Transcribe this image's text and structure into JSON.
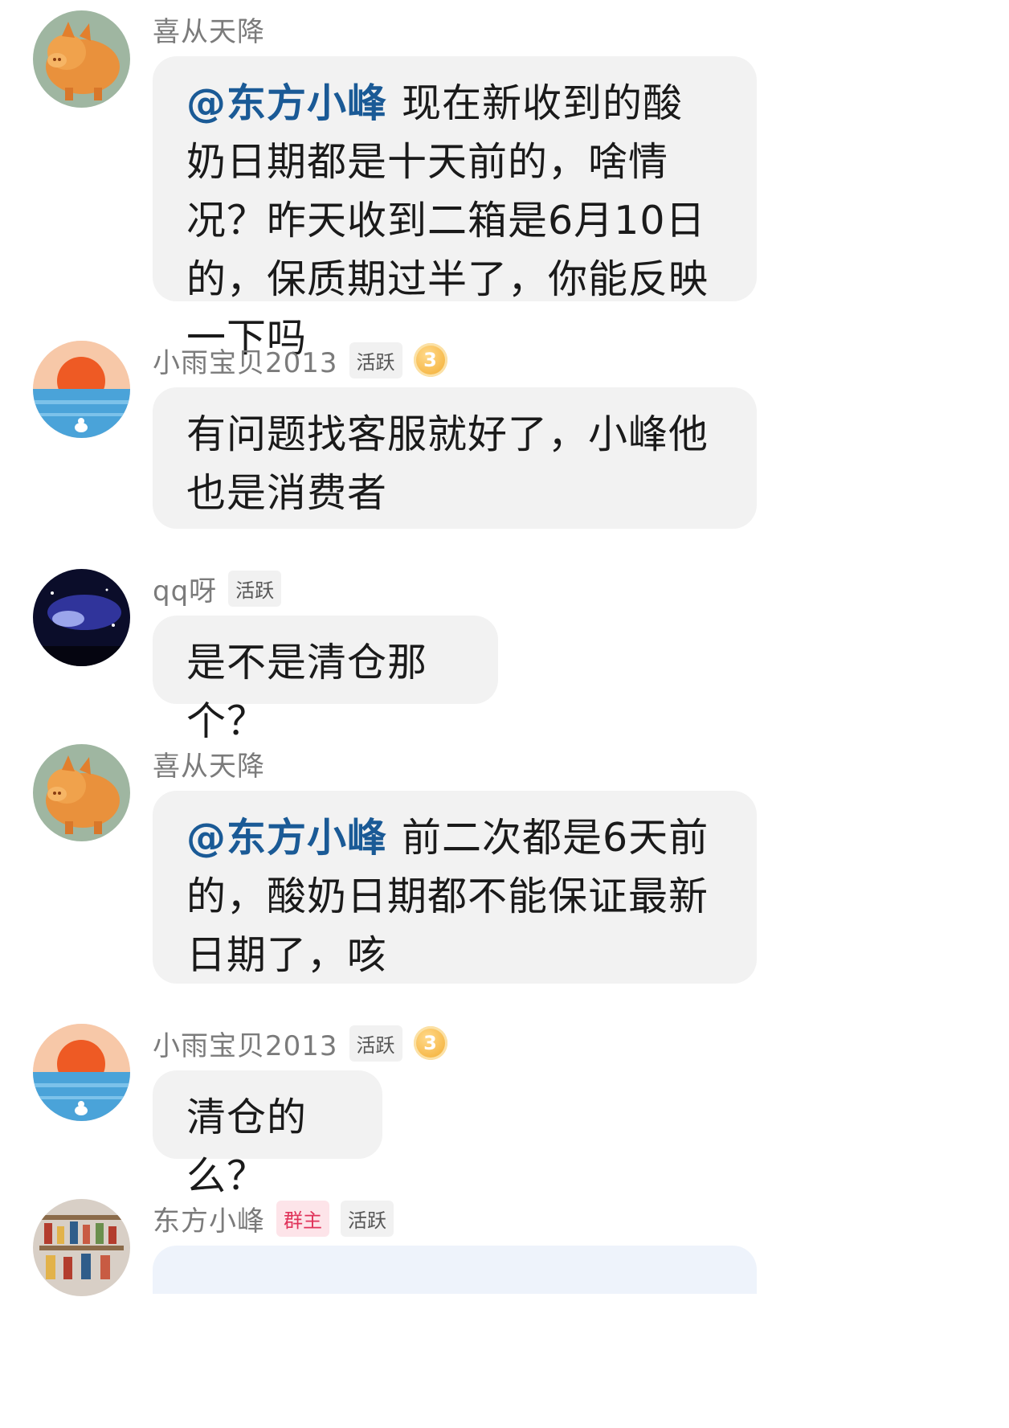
{
  "messages": [
    {
      "sender": "喜从天降",
      "avatar": "pig-avatar-icon",
      "mention": "@东方小峰",
      "text": "现在新收到的酸奶日期都是十天前的，啥情况？昨天收到二箱是6月10日的，保质期过半了，你能反映一下吗"
    },
    {
      "sender": "小雨宝贝2013",
      "avatar": "sunset-avatar-icon",
      "tags": [
        "活跃"
      ],
      "level": "3",
      "text": "有问题找客服就好了，小峰他也是消费者"
    },
    {
      "sender": "qq呀",
      "avatar": "night-sky-avatar-icon",
      "tags": [
        "活跃"
      ],
      "text": "是不是清仓那个？"
    },
    {
      "sender": "喜从天降",
      "avatar": "pig-avatar-icon",
      "mention": "@东方小峰",
      "text": "前二次都是6天前的，酸奶日期都不能保证最新日期了，咳"
    },
    {
      "sender": "小雨宝贝2013",
      "avatar": "sunset-avatar-icon",
      "tags": [
        "活跃"
      ],
      "level": "3",
      "text": "清仓的么？"
    },
    {
      "sender": "东方小峰",
      "avatar": "shop-shelf-avatar-icon",
      "tags": [
        "群主",
        "活跃"
      ]
    }
  ]
}
